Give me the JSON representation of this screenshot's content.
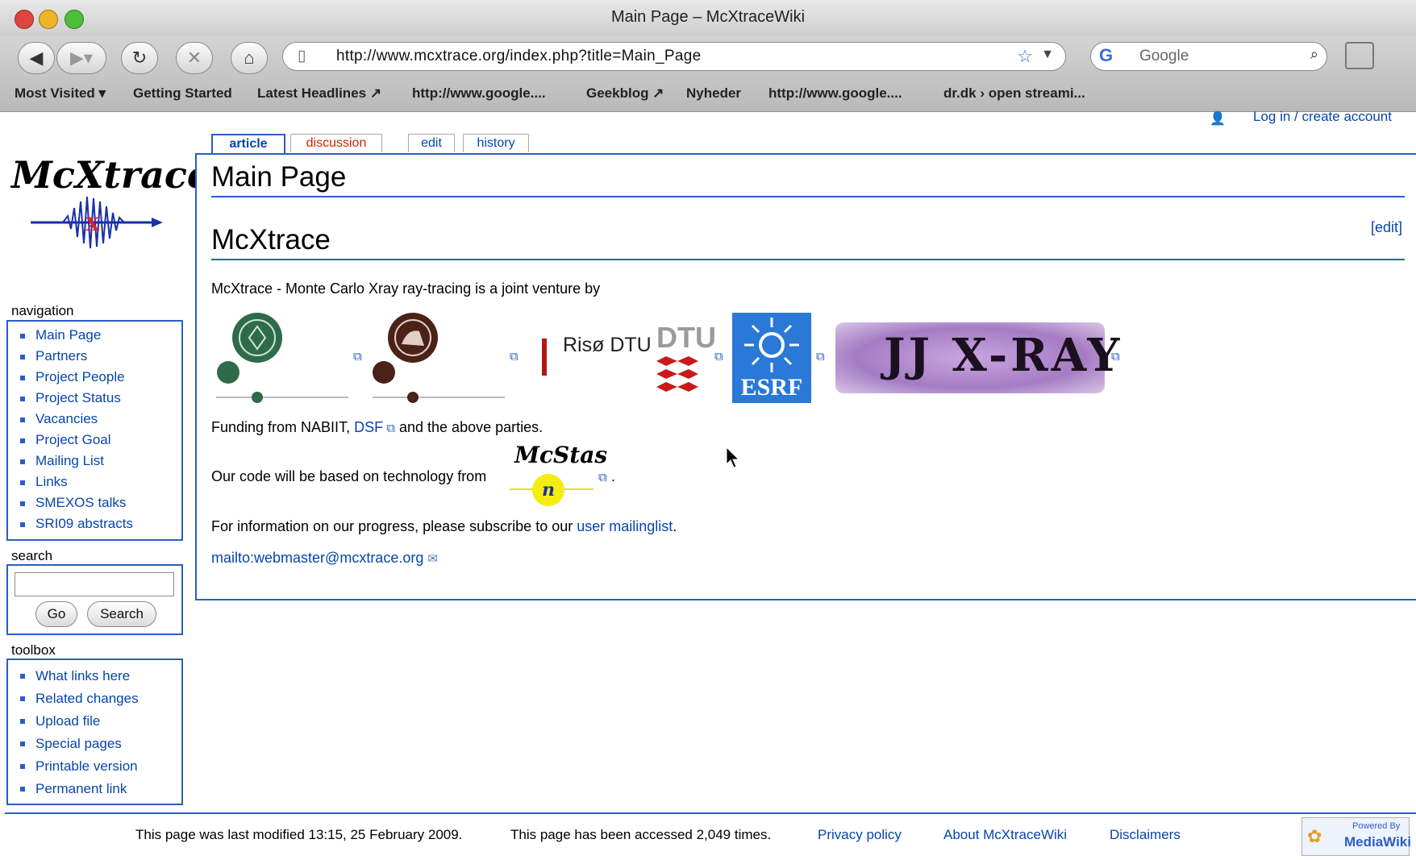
{
  "window": {
    "title": "Main Page – McXtraceWiki"
  },
  "toolbar": {
    "url": "http://www.mcxtrace.org/index.php?title=Main_Page",
    "search_placeholder": "Google"
  },
  "bookmarks": [
    "Most Visited ▾",
    "Getting Started",
    "Latest Headlines ↗",
    "http://www.google....",
    "Geekblog ↗",
    "Nyheder",
    "http://www.google....",
    "dr.dk › open streami..."
  ],
  "page": {
    "login": "Log in / create account",
    "logo_text": "McXtrace",
    "tabs": {
      "article": "article",
      "discussion": "discussion",
      "edit": "edit",
      "history": "history"
    },
    "title": "Main Page",
    "section_title": "McXtrace",
    "section_edit": "[edit]",
    "intro": "McXtrace - Monte Carlo Xray ray-tracing is a joint venture by",
    "partners": {
      "riso": "Risø DTU",
      "dtu": "DTU",
      "esrf": "ESRF",
      "jj": "JJ X-RAY"
    },
    "funding_prefix": "Funding from NABIIT,",
    "funding_link": "DSF",
    "funding_suffix": "and the above parties.",
    "code_prefix": "Our code will be based on technology from",
    "mcstas_logo": "McStas",
    "mcstas_n": "n",
    "progress_prefix": "For information on our progress, please subscribe to our",
    "progress_link": "user mailinglist",
    "progress_suffix": ".",
    "mailto": "mailto:webmaster@mcxtrace.org"
  },
  "sidebar": {
    "navigation_title": "navigation",
    "navigation": [
      "Main Page",
      "Partners",
      "Project People",
      "Project Status",
      "Vacancies",
      "Project Goal",
      "Mailing List",
      "Links",
      "SMEXOS talks",
      "SRI09 abstracts"
    ],
    "search_title": "search",
    "go_label": "Go",
    "search_label": "Search",
    "toolbox_title": "toolbox",
    "toolbox": [
      "What links here",
      "Related changes",
      "Upload file",
      "Special pages",
      "Printable version",
      "Permanent link"
    ]
  },
  "footer": {
    "modified": "This page was last modified 13:15, 25 February 2009.",
    "accessed": "This page has been accessed 2,049 times.",
    "privacy": "Privacy policy",
    "about": "About McXtraceWiki",
    "disclaimers": "Disclaimers",
    "powered_by": "Powered By",
    "mediawiki": "MediaWiki"
  },
  "colors": {
    "link": "#0645ad",
    "border": "#2a5ec4",
    "discussion": "#cc2200"
  }
}
